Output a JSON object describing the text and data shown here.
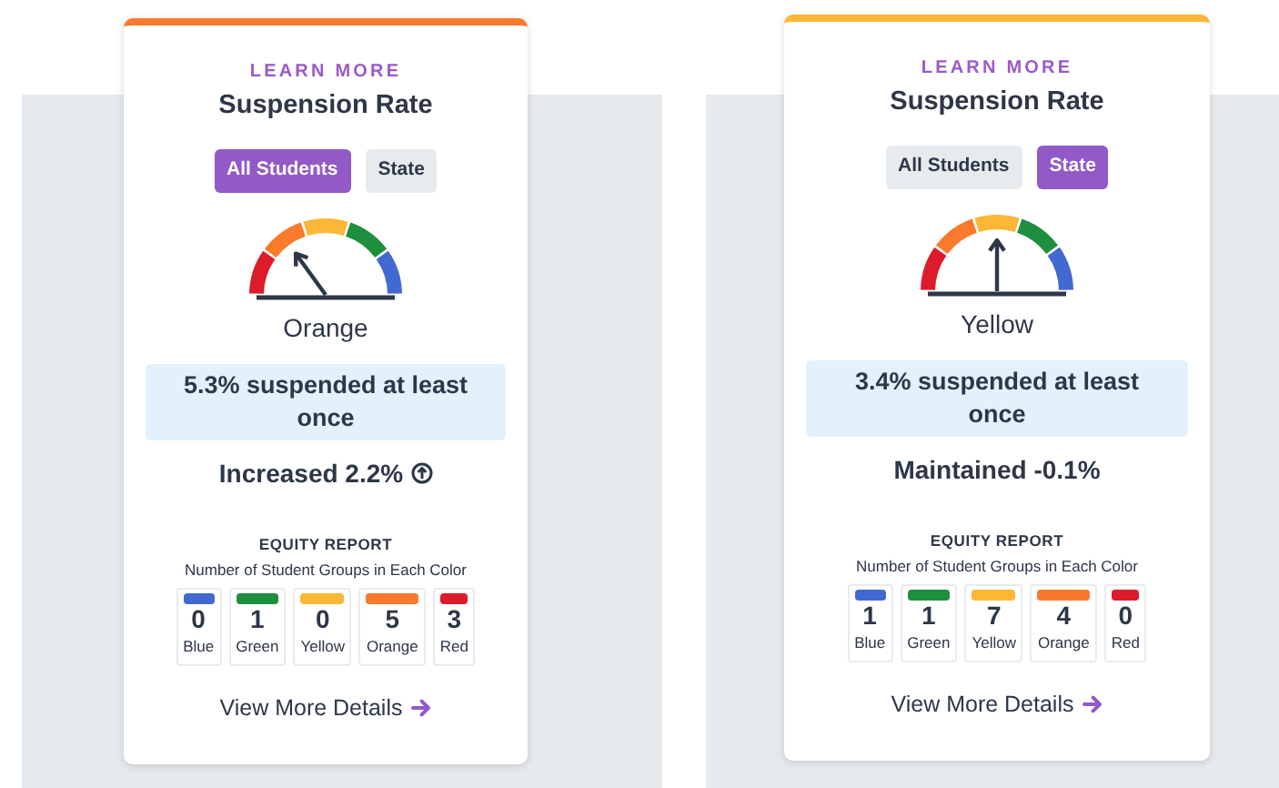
{
  "cards": [
    {
      "kind": "increased",
      "color": "#f97a2c",
      "eyebrow": "LEARN MORE",
      "title": "Suspension Rate",
      "toggles": [
        {
          "label": "All Students",
          "selected": true
        },
        {
          "label": "State",
          "selected": false
        }
      ],
      "rating": "Orange",
      "stat": "5.3% suspended at least once",
      "change": "Increased 2.2%",
      "equity": {
        "title": "EQUITY REPORT",
        "subtitle": "Number of Student Groups in Each Color",
        "groups": [
          {
            "color": "#4169d1",
            "count": "0",
            "label": "Blue"
          },
          {
            "color": "#1e8f3e",
            "count": "1",
            "label": "Green"
          },
          {
            "color": "#fbb735",
            "count": "0",
            "label": "Yellow"
          },
          {
            "color": "#f97a2c",
            "count": "5",
            "label": "Orange"
          },
          {
            "color": "#dc1c2b",
            "count": "3",
            "label": "Red"
          }
        ]
      },
      "link": "View More Details"
    },
    {
      "kind": "maintained",
      "color": "#fbb735",
      "eyebrow": "LEARN MORE",
      "title": "Suspension Rate",
      "toggles": [
        {
          "label": "All Students",
          "selected": false
        },
        {
          "label": "State",
          "selected": true
        }
      ],
      "rating": "Yellow",
      "stat": "3.4% suspended at least once",
      "change": "Maintained -0.1%",
      "equity": {
        "title": "EQUITY REPORT",
        "subtitle": "Number of Student Groups in Each Color",
        "groups": [
          {
            "color": "#4169d1",
            "count": "1",
            "label": "Blue"
          },
          {
            "color": "#1e8f3e",
            "count": "1",
            "label": "Green"
          },
          {
            "color": "#fbb735",
            "count": "7",
            "label": "Yellow"
          },
          {
            "color": "#f97a2c",
            "count": "4",
            "label": "Orange"
          },
          {
            "color": "#dc1c2b",
            "count": "0",
            "label": "Red"
          }
        ]
      },
      "link": "View More Details"
    }
  ]
}
